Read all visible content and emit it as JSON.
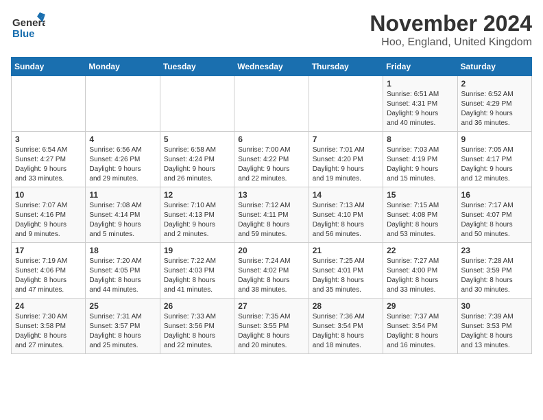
{
  "logo": {
    "general": "General",
    "blue": "Blue"
  },
  "title": "November 2024",
  "location": "Hoo, England, United Kingdom",
  "days_of_week": [
    "Sunday",
    "Monday",
    "Tuesday",
    "Wednesday",
    "Thursday",
    "Friday",
    "Saturday"
  ],
  "weeks": [
    [
      {
        "num": "",
        "info": ""
      },
      {
        "num": "",
        "info": ""
      },
      {
        "num": "",
        "info": ""
      },
      {
        "num": "",
        "info": ""
      },
      {
        "num": "",
        "info": ""
      },
      {
        "num": "1",
        "info": "Sunrise: 6:51 AM\nSunset: 4:31 PM\nDaylight: 9 hours\nand 40 minutes."
      },
      {
        "num": "2",
        "info": "Sunrise: 6:52 AM\nSunset: 4:29 PM\nDaylight: 9 hours\nand 36 minutes."
      }
    ],
    [
      {
        "num": "3",
        "info": "Sunrise: 6:54 AM\nSunset: 4:27 PM\nDaylight: 9 hours\nand 33 minutes."
      },
      {
        "num": "4",
        "info": "Sunrise: 6:56 AM\nSunset: 4:26 PM\nDaylight: 9 hours\nand 29 minutes."
      },
      {
        "num": "5",
        "info": "Sunrise: 6:58 AM\nSunset: 4:24 PM\nDaylight: 9 hours\nand 26 minutes."
      },
      {
        "num": "6",
        "info": "Sunrise: 7:00 AM\nSunset: 4:22 PM\nDaylight: 9 hours\nand 22 minutes."
      },
      {
        "num": "7",
        "info": "Sunrise: 7:01 AM\nSunset: 4:20 PM\nDaylight: 9 hours\nand 19 minutes."
      },
      {
        "num": "8",
        "info": "Sunrise: 7:03 AM\nSunset: 4:19 PM\nDaylight: 9 hours\nand 15 minutes."
      },
      {
        "num": "9",
        "info": "Sunrise: 7:05 AM\nSunset: 4:17 PM\nDaylight: 9 hours\nand 12 minutes."
      }
    ],
    [
      {
        "num": "10",
        "info": "Sunrise: 7:07 AM\nSunset: 4:16 PM\nDaylight: 9 hours\nand 9 minutes."
      },
      {
        "num": "11",
        "info": "Sunrise: 7:08 AM\nSunset: 4:14 PM\nDaylight: 9 hours\nand 5 minutes."
      },
      {
        "num": "12",
        "info": "Sunrise: 7:10 AM\nSunset: 4:13 PM\nDaylight: 9 hours\nand 2 minutes."
      },
      {
        "num": "13",
        "info": "Sunrise: 7:12 AM\nSunset: 4:11 PM\nDaylight: 8 hours\nand 59 minutes."
      },
      {
        "num": "14",
        "info": "Sunrise: 7:13 AM\nSunset: 4:10 PM\nDaylight: 8 hours\nand 56 minutes."
      },
      {
        "num": "15",
        "info": "Sunrise: 7:15 AM\nSunset: 4:08 PM\nDaylight: 8 hours\nand 53 minutes."
      },
      {
        "num": "16",
        "info": "Sunrise: 7:17 AM\nSunset: 4:07 PM\nDaylight: 8 hours\nand 50 minutes."
      }
    ],
    [
      {
        "num": "17",
        "info": "Sunrise: 7:19 AM\nSunset: 4:06 PM\nDaylight: 8 hours\nand 47 minutes."
      },
      {
        "num": "18",
        "info": "Sunrise: 7:20 AM\nSunset: 4:05 PM\nDaylight: 8 hours\nand 44 minutes."
      },
      {
        "num": "19",
        "info": "Sunrise: 7:22 AM\nSunset: 4:03 PM\nDaylight: 8 hours\nand 41 minutes."
      },
      {
        "num": "20",
        "info": "Sunrise: 7:24 AM\nSunset: 4:02 PM\nDaylight: 8 hours\nand 38 minutes."
      },
      {
        "num": "21",
        "info": "Sunrise: 7:25 AM\nSunset: 4:01 PM\nDaylight: 8 hours\nand 35 minutes."
      },
      {
        "num": "22",
        "info": "Sunrise: 7:27 AM\nSunset: 4:00 PM\nDaylight: 8 hours\nand 33 minutes."
      },
      {
        "num": "23",
        "info": "Sunrise: 7:28 AM\nSunset: 3:59 PM\nDaylight: 8 hours\nand 30 minutes."
      }
    ],
    [
      {
        "num": "24",
        "info": "Sunrise: 7:30 AM\nSunset: 3:58 PM\nDaylight: 8 hours\nand 27 minutes."
      },
      {
        "num": "25",
        "info": "Sunrise: 7:31 AM\nSunset: 3:57 PM\nDaylight: 8 hours\nand 25 minutes."
      },
      {
        "num": "26",
        "info": "Sunrise: 7:33 AM\nSunset: 3:56 PM\nDaylight: 8 hours\nand 22 minutes."
      },
      {
        "num": "27",
        "info": "Sunrise: 7:35 AM\nSunset: 3:55 PM\nDaylight: 8 hours\nand 20 minutes."
      },
      {
        "num": "28",
        "info": "Sunrise: 7:36 AM\nSunset: 3:54 PM\nDaylight: 8 hours\nand 18 minutes."
      },
      {
        "num": "29",
        "info": "Sunrise: 7:37 AM\nSunset: 3:54 PM\nDaylight: 8 hours\nand 16 minutes."
      },
      {
        "num": "30",
        "info": "Sunrise: 7:39 AM\nSunset: 3:53 PM\nDaylight: 8 hours\nand 13 minutes."
      }
    ]
  ]
}
